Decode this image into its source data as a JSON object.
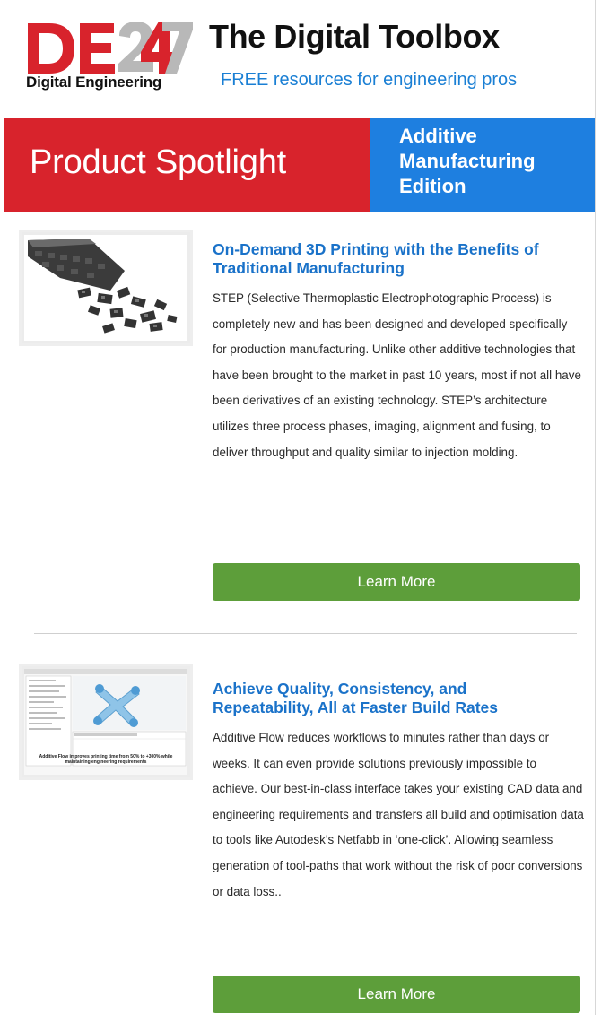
{
  "header": {
    "logo_letters": "DE247",
    "logo_tagline": "Digital Engineering",
    "title": "The Digital Toolbox",
    "subtitle": "FREE resources for engineering pros"
  },
  "banner": {
    "left_text": "Product Spotlight",
    "right_lines": [
      "Additive",
      "Manufacturing",
      "Edition"
    ]
  },
  "articles": [
    {
      "title": "On-Demand 3D Printing with the Benefits of Traditional Manufacturing",
      "body": "STEP (Selective Thermoplastic Electrophotographic Process) is completely new and has been designed and developed specifically for production manufacturing. Unlike other additive technologies that have been brought to the market in past 10 years, most if not all have been derivatives of an existing technology. STEP’s architecture utilizes three process phases, imaging, alignment and fusing, to deliver throughput and quality similar to injection molding.",
      "button_label": "Learn More",
      "image": "3d-printed-parts-image"
    },
    {
      "title": "Achieve Quality, Consistency, and Repeatability, All at Faster Build Rates",
      "body": "Additive Flow reduces workflows to minutes rather than days or weeks. It can even provide solutions previously impossible to achieve. Our best-in-class interface takes your existing CAD data and engineering requirements and transfers all build and optimisation data to tools like Autodesk’s Netfabb in ‘one-click’. Allowing seamless generation of tool-paths that work without the risk of poor conversions or data loss..",
      "button_label": "Learn More",
      "image": "additive-flow-software-screenshot",
      "image_caption": "Additive Flow improves printing time from 50% to +300% while maintaining engineering requirements"
    }
  ],
  "colors": {
    "brand_red": "#d8232c",
    "brand_blue": "#1e7fe0",
    "title_blue": "#1a72c9",
    "button_green": "#5d9e3a"
  }
}
